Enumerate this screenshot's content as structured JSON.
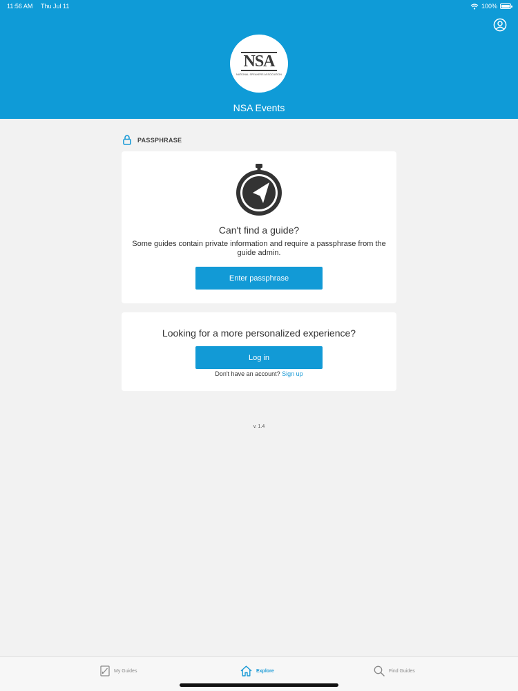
{
  "status_bar": {
    "time": "11:56 AM",
    "date": "Thu Jul 11",
    "battery": "100%"
  },
  "header": {
    "logo_text": "NSA",
    "logo_subtext": "NATIONAL SPEAKERS ASSOCIATION",
    "title": "NSA Events",
    "background_color": "#0f9bd7"
  },
  "passphrase_section": {
    "label": "PASSPHRASE",
    "card": {
      "title": "Can't find a guide?",
      "description": "Some guides contain private information and require a passphrase from the guide admin.",
      "button_label": "Enter passphrase"
    }
  },
  "login_card": {
    "title": "Looking for a more personalized experience?",
    "button_label": "Log in",
    "no_account_text": "Don't have an account?",
    "signup_link": "Sign up"
  },
  "version": "v. 1.4",
  "tab_bar": {
    "tabs": [
      {
        "label": "My Guides",
        "icon": "my-guides-icon",
        "active": false
      },
      {
        "label": "Explore",
        "icon": "home-icon",
        "active": true
      },
      {
        "label": "Find Guides",
        "icon": "search-icon",
        "active": false
      }
    ]
  },
  "colors": {
    "accent": "#1a9ad6",
    "button": "#129ad6",
    "background": "#f2f2f2"
  }
}
